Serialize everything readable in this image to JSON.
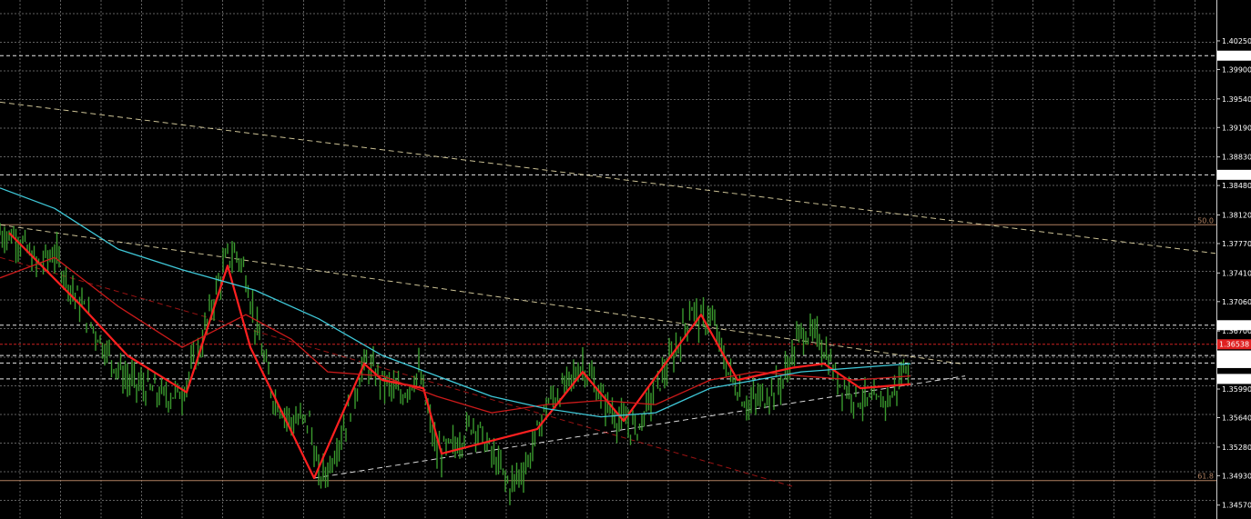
{
  "chart_data": {
    "type": "line",
    "grid": true,
    "y_axis": {
      "side": "right",
      "range": [
        1.344,
        1.4075
      ],
      "ticks": [
        "1.40250",
        "1.39900",
        "1.39540",
        "1.39190",
        "1.38830",
        "1.38480",
        "1.38120",
        "1.37770",
        "1.37410",
        "1.37060",
        "1.36700",
        "1.35990",
        "1.35640",
        "1.35280",
        "1.34930",
        "1.34570"
      ]
    },
    "price_markers": [
      {
        "label": "1.40069",
        "value": 1.40069,
        "style": "white-box"
      },
      {
        "label": "1.38611",
        "value": 1.38611,
        "style": "white-box"
      },
      {
        "label": "1.36771",
        "value": 1.36771,
        "style": "white-box"
      },
      {
        "label": "1.36538",
        "value": 1.36538,
        "style": "red-box"
      },
      {
        "label": "1.36401",
        "value": 1.36401,
        "style": "white-box"
      },
      {
        "label": "1.36308",
        "value": 1.36308,
        "style": "white-box"
      },
      {
        "label": "1.36114",
        "value": 1.36114,
        "style": "white-box"
      }
    ],
    "fibonacci_levels": [
      {
        "label": "50.0",
        "value": 1.38
      },
      {
        "label": "61.8",
        "value": 1.3487
      }
    ],
    "colors": {
      "background": "#000000",
      "grid": "#8a8a8a",
      "price": "#3a9a2e",
      "zigzag": "#ff2020",
      "ma_fast": "#cc1a1a",
      "ma_slow": "#3fc8d8",
      "trendline": "#f0e4b0",
      "fib": "#b08060",
      "hline_white": "#e8e8e8",
      "hline_red": "#cc2020"
    },
    "series": [
      {
        "style": "price-bars",
        "x": [
          0,
          20,
          40,
          60,
          80,
          100,
          120,
          140,
          160,
          180,
          200,
          220,
          240,
          250,
          260,
          270,
          280,
          300,
          320,
          340,
          350,
          360,
          380,
          400,
          420,
          440,
          460,
          480,
          500,
          520,
          540,
          560,
          580,
          600,
          620,
          640,
          660,
          680,
          700,
          720,
          740,
          760,
          770,
          780,
          800,
          820,
          840,
          860,
          880,
          900,
          920,
          940,
          960,
          980,
          1000
        ],
        "values": [
          1.379,
          1.3785,
          1.375,
          1.3765,
          1.372,
          1.368,
          1.364,
          1.361,
          1.36,
          1.359,
          1.3595,
          1.365,
          1.373,
          1.376,
          1.3765,
          1.374,
          1.368,
          1.359,
          1.356,
          1.356,
          1.349,
          1.35,
          1.356,
          1.363,
          1.361,
          1.359,
          1.362,
          1.352,
          1.353,
          1.356,
          1.352,
          1.348,
          1.351,
          1.358,
          1.36,
          1.363,
          1.359,
          1.356,
          1.355,
          1.36,
          1.364,
          1.37,
          1.368,
          1.369,
          1.362,
          1.358,
          1.359,
          1.361,
          1.367,
          1.366,
          1.361,
          1.359,
          1.358,
          1.359,
          1.364
        ]
      },
      {
        "style": "zigzag",
        "x": [
          10,
          90,
          140,
          205,
          250,
          275,
          345,
          400,
          420,
          465,
          485,
          590,
          640,
          685,
          770,
          810,
          870,
          905,
          945,
          1000
        ],
        "values": [
          1.379,
          1.37,
          1.364,
          1.3595,
          1.375,
          1.365,
          1.349,
          1.363,
          1.361,
          1.36,
          1.352,
          1.355,
          1.362,
          1.356,
          1.369,
          1.361,
          1.3625,
          1.363,
          1.36,
          1.3605
        ]
      },
      {
        "style": "ma_fast",
        "x": [
          0,
          60,
          130,
          200,
          270,
          320,
          360,
          420,
          480,
          540,
          600,
          660,
          720,
          780,
          830,
          880,
          940,
          1000
        ],
        "values": [
          1.3735,
          1.376,
          1.37,
          1.365,
          1.369,
          1.366,
          1.362,
          1.3615,
          1.359,
          1.357,
          1.358,
          1.3585,
          1.358,
          1.361,
          1.362,
          1.3615,
          1.361,
          1.3615
        ]
      },
      {
        "style": "ma_slow",
        "x": [
          0,
          60,
          130,
          200,
          280,
          350,
          420,
          480,
          540,
          600,
          660,
          720,
          780,
          830,
          880,
          940,
          1000
        ],
        "values": [
          1.3845,
          1.382,
          1.377,
          1.3745,
          1.372,
          1.3685,
          1.364,
          1.3615,
          1.359,
          1.3575,
          1.3565,
          1.357,
          1.36,
          1.361,
          1.362,
          1.3625,
          1.363
        ]
      }
    ],
    "trendlines": [
      {
        "style": "dashed-cream",
        "x": [
          0,
          1335
        ],
        "values": [
          1.395,
          1.3765
        ]
      },
      {
        "style": "dashed-cream",
        "x": [
          0,
          1055
        ],
        "values": [
          1.38,
          1.363
        ]
      },
      {
        "style": "dashed-white",
        "x": [
          345,
          1060
        ],
        "values": [
          1.349,
          1.3615
        ]
      },
      {
        "style": "dashed-red",
        "x": [
          0,
          870
        ],
        "values": [
          1.376,
          1.348
        ]
      }
    ]
  }
}
